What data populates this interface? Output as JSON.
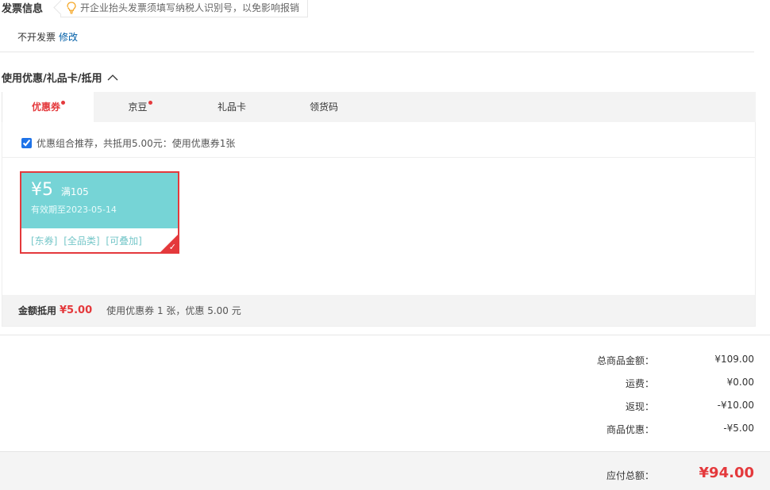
{
  "invoice": {
    "title": "发票信息",
    "tip": "开企业抬头发票须填写纳税人识别号，以免影响报销",
    "status": "不开发票",
    "edit_link": "修改"
  },
  "coupons": {
    "header": "使用优惠/礼品卡/抵用",
    "tabs": [
      {
        "label": "优惠券",
        "active": true,
        "dot": true
      },
      {
        "label": "京豆",
        "active": false,
        "dot": true
      },
      {
        "label": "礼品卡",
        "active": false,
        "dot": false
      },
      {
        "label": "领货码",
        "active": false,
        "dot": false
      }
    ],
    "recommend_text": "优惠组合推荐，共抵用5.00元：使用优惠券1张",
    "recommend_checked": true,
    "coupon_card": {
      "amount": "¥5",
      "condition": "满105",
      "expiry": "有效期至2023-05-14",
      "tags": [
        "[东券]",
        "[全品类]",
        "[可叠加]"
      ],
      "color_top": "#76d4d6",
      "color_border": "#e4393c"
    },
    "summary": {
      "label": "金额抵用",
      "value": "¥5.00",
      "detail": "使用优惠券 1 张，优惠 5.00 元"
    }
  },
  "totals": {
    "rows": [
      {
        "label": "总商品金额：",
        "value": "¥109.00"
      },
      {
        "label": "运费：",
        "value": "¥0.00"
      },
      {
        "label": "返现：",
        "value": "-¥10.00"
      },
      {
        "label": "商品优惠：",
        "value": "-¥5.00"
      }
    ],
    "payable_label": "应付总额：",
    "payable_value": "¥94.00"
  },
  "colors": {
    "accent": "#e4393c",
    "link": "#005ea7",
    "coupon_teal": "#76d4d6"
  }
}
